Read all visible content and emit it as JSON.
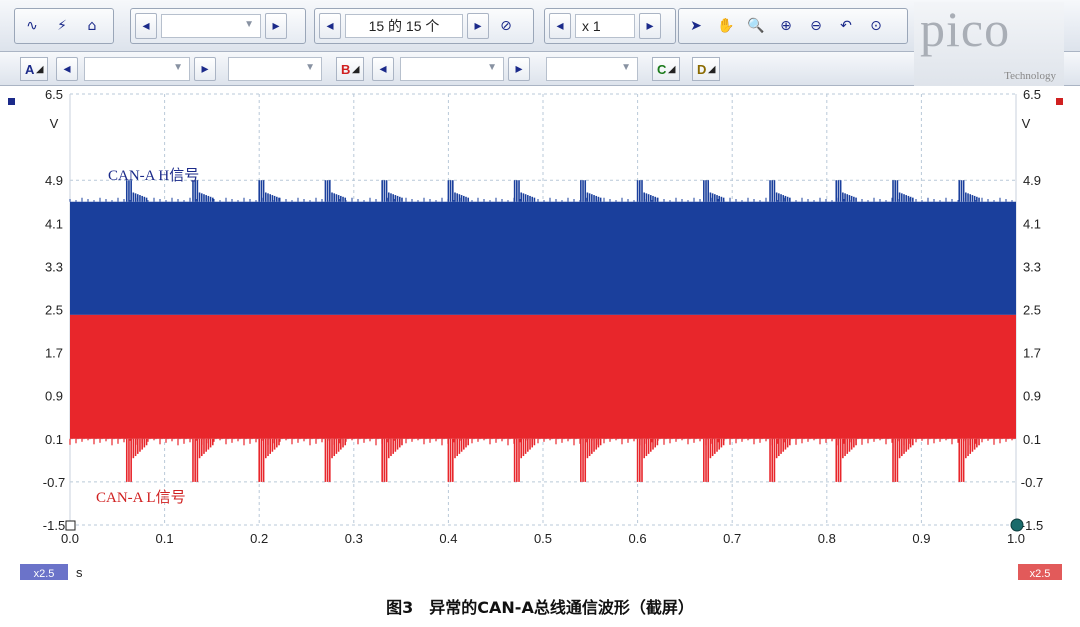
{
  "toolbar": {
    "page_counter": "15 的 15 个",
    "zoom_value": "x 1",
    "logo_text": "pico",
    "logo_sub": "Technology",
    "channels": [
      {
        "label": "A",
        "color": "#1b2a8a"
      },
      {
        "label": "B",
        "color": "#d02020"
      },
      {
        "label": "C",
        "color": "#1a7a1a"
      },
      {
        "label": "D",
        "color": "#8a6a00"
      }
    ]
  },
  "scope": {
    "left_unit": "V",
    "right_unit": "V",
    "y_ticks": [
      "6.5",
      "4.9",
      "4.1",
      "3.3",
      "2.5",
      "1.7",
      "0.9",
      "0.1",
      "-0.7",
      "-1.5"
    ],
    "x_ticks": [
      "0.0",
      "0.1",
      "0.2",
      "0.3",
      "0.4",
      "0.5",
      "0.6",
      "0.7",
      "0.8",
      "0.9",
      "1.0"
    ],
    "x_unit": "s",
    "left_scale_badge": "x2.5",
    "right_scale_badge": "x2.5",
    "label_h": "CAN-A H信号",
    "label_l": "CAN-A L信号",
    "colors": {
      "channel_a": "#1a3f9c",
      "channel_b": "#e8262b",
      "grid": "#b9c9d8"
    }
  },
  "chart_data": {
    "type": "area",
    "x_unit": "s",
    "y_unit": "V",
    "xlim": [
      0.0,
      1.0
    ],
    "ylim": [
      -1.5,
      6.5
    ],
    "grid": true,
    "series": [
      {
        "name": "CAN-A H信号",
        "color": "#1a3f9c",
        "low": 2.4,
        "high": 4.5,
        "peak": 4.9,
        "burst_times": [
          0.06,
          0.13,
          0.2,
          0.27,
          0.33,
          0.4,
          0.47,
          0.54,
          0.6,
          0.67,
          0.74,
          0.81,
          0.87,
          0.94
        ]
      },
      {
        "name": "CAN-A L信号",
        "color": "#e8262b",
        "low": 0.1,
        "high": 2.4,
        "dip": -0.7,
        "burst_times": [
          0.06,
          0.13,
          0.2,
          0.27,
          0.33,
          0.4,
          0.47,
          0.54,
          0.6,
          0.67,
          0.74,
          0.81,
          0.87,
          0.94
        ]
      }
    ]
  },
  "caption": "图3　异常的CAN-A总线通信波形（截屏）"
}
